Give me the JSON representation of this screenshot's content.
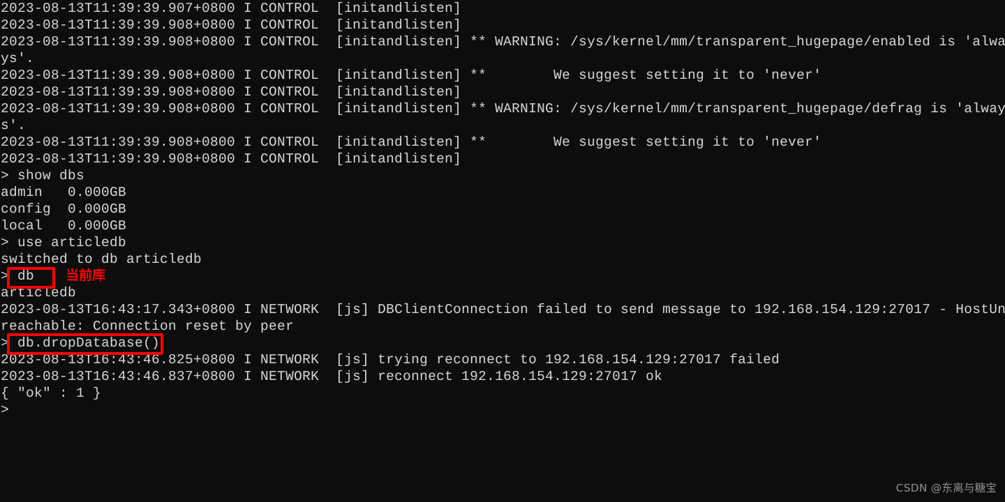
{
  "terminal": {
    "background_color": "#0d0d0d",
    "text_color": "#d4d7da",
    "lines": [
      "2023-08-13T11:39:39.907+0800 I CONTROL  [initandlisten]",
      "2023-08-13T11:39:39.908+0800 I CONTROL  [initandlisten]",
      "2023-08-13T11:39:39.908+0800 I CONTROL  [initandlisten] ** WARNING: /sys/kernel/mm/transparent_hugepage/enabled is 'alwa",
      "ys'.",
      "2023-08-13T11:39:39.908+0800 I CONTROL  [initandlisten] **        We suggest setting it to 'never'",
      "2023-08-13T11:39:39.908+0800 I CONTROL  [initandlisten]",
      "2023-08-13T11:39:39.908+0800 I CONTROL  [initandlisten] ** WARNING: /sys/kernel/mm/transparent_hugepage/defrag is 'alway",
      "s'.",
      "2023-08-13T11:39:39.908+0800 I CONTROL  [initandlisten] **        We suggest setting it to 'never'",
      "2023-08-13T11:39:39.908+0800 I CONTROL  [initandlisten]",
      "> show dbs",
      "admin   0.000GB",
      "config  0.000GB",
      "local   0.000GB",
      "> use articledb",
      "switched to db articledb",
      "> db",
      "articledb",
      "2023-08-13T16:43:17.343+0800 I NETWORK  [js] DBClientConnection failed to send message to 192.168.154.129:27017 - HostUn",
      "reachable: Connection reset by peer",
      "> db.dropDatabase()",
      "2023-08-13T16:43:46.825+0800 I NETWORK  [js] trying reconnect to 192.168.154.129:27017 failed",
      "2023-08-13T16:43:46.837+0800 I NETWORK  [js] reconnect 192.168.154.129:27017 ok",
      "{ \"ok\" : 1 }",
      ">"
    ]
  },
  "annotations": {
    "color": "#fe0000",
    "current_db_label": "当前库",
    "boxed_command_db": "db",
    "boxed_command_drop": "db.dropDatabase()"
  },
  "watermark": {
    "text": "CSDN @东离与糖宝",
    "color": "#8e9194"
  }
}
